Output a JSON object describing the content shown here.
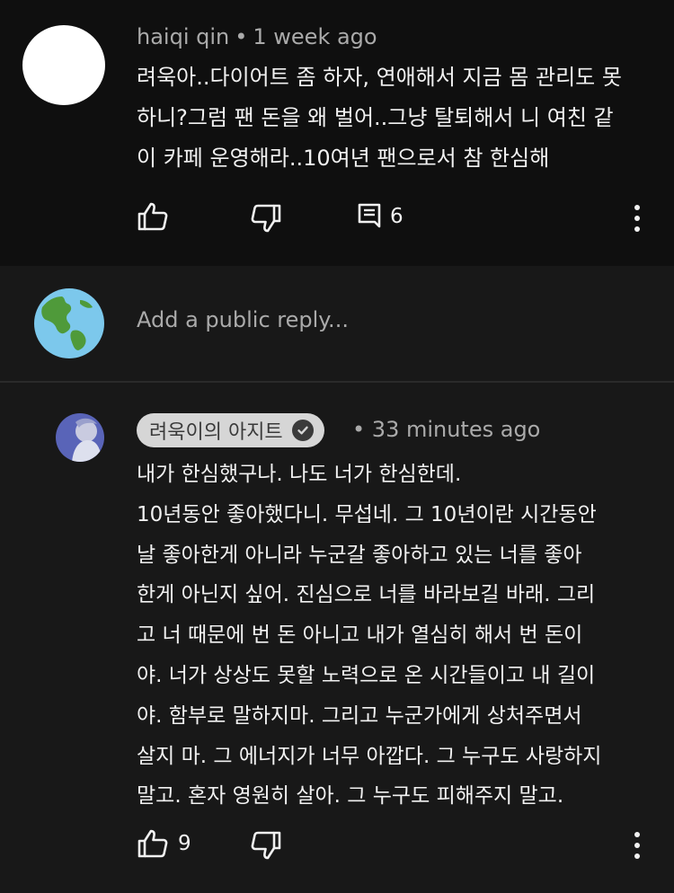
{
  "comment": {
    "author": "haiqi qin",
    "separator": "•",
    "time": "1 week ago",
    "lines": [
      "려욱아..다이어트 좀 하자, 연애해서 지금 몸 관리도 못",
      "하니?그럼 팬 돈을 왜 벌어..그냥 탈퇴해서 니 여친 같",
      "이 카페 운영해라..10여년 팬으로서 참 한심해"
    ],
    "reply_count": "6"
  },
  "reply_box": {
    "placeholder": "Add a public reply..."
  },
  "reply": {
    "author": "려욱이의 아지트",
    "separator": "•",
    "time": "33 minutes ago",
    "lines": [
      "내가 한심했구나. 나도 너가 한심한데.",
      "10년동안 좋아했다니. 무섭네. 그 10년이란 시간동안",
      "날 좋아한게 아니라 누군갈 좋아하고 있는 너를 좋아",
      "한게 아닌지 싶어. 진심으로 너를 바라보길 바래. 그리",
      "고 너 때문에 번 돈 아니고 내가 열심히 해서 번 돈이",
      "야. 너가 상상도 못할 노력으로 온 시간들이고 내 길이",
      "야. 함부로 말하지마. 그리고 누군가에게 상처주면서",
      "살지 마. 그 에너지가 너무 아깝다. 그 누구도 사랑하지",
      "말고. 혼자 영원히 살아. 그 누구도 피해주지 말고."
    ],
    "like_count": "9"
  }
}
